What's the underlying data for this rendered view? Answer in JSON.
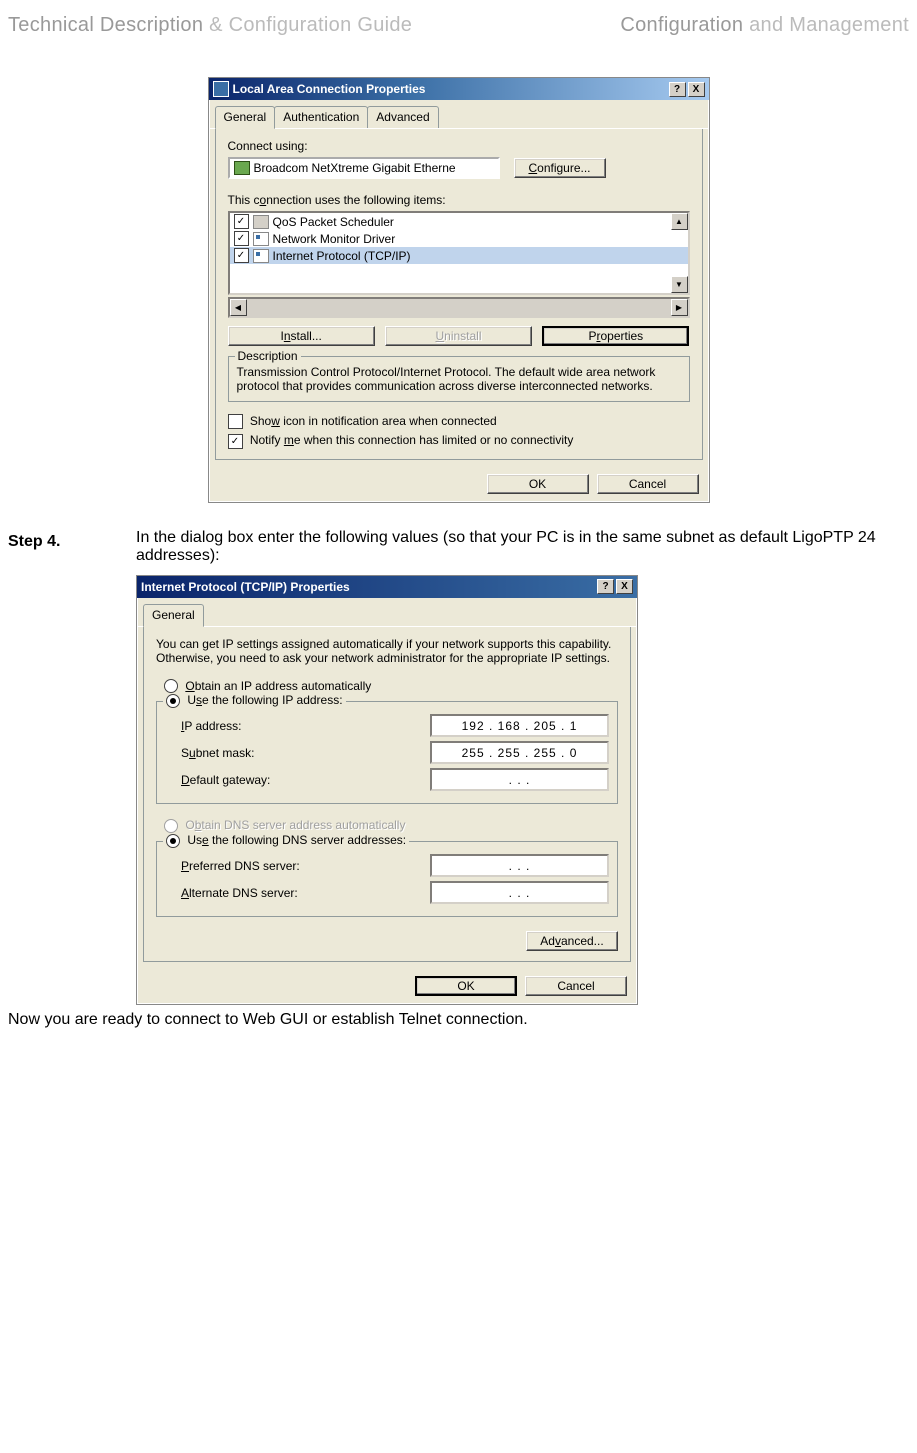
{
  "header": {
    "left_bold": "Technical Description",
    "left_slim": " & Configuration Guide",
    "right_bold": "Configuration",
    "right_slim": " and Management"
  },
  "dialog1": {
    "title": "Local Area Connection Properties",
    "help_btn": "?",
    "close_btn": "X",
    "tabs": [
      "General",
      "Authentication",
      "Advanced"
    ],
    "connect_label": "Connect using:",
    "adapter": "Broadcom NetXtreme Gigabit Etherne",
    "configure_btn": "Configure...",
    "items_label": "This connection uses the following items:",
    "items": [
      {
        "checked": true,
        "label": "QoS Packet Scheduler"
      },
      {
        "checked": true,
        "label": "Network Monitor Driver"
      },
      {
        "checked": true,
        "label": "Internet Protocol (TCP/IP)",
        "selected": true
      }
    ],
    "install_btn": "Install...",
    "uninstall_btn": "Uninstall",
    "properties_btn": "Properties",
    "desc_legend": "Description",
    "desc_text": "Transmission Control Protocol/Internet Protocol. The default wide area network protocol that provides communication across diverse interconnected networks.",
    "show_icon": {
      "checked": false,
      "label": "Show icon in notification area when connected"
    },
    "notify": {
      "checked": true,
      "label": "Notify me when this connection has limited or no connectivity"
    },
    "ok": "OK",
    "cancel": "Cancel"
  },
  "step4": {
    "label": "Step 4.",
    "text": "In the dialog box enter the following values (so that your PC is in the same subnet as default LigoPTP 24 addresses):"
  },
  "dialog2": {
    "title": "Internet Protocol (TCP/IP) Properties",
    "help_btn": "?",
    "close_btn": "X",
    "tab": "General",
    "intro": "You can get IP settings assigned automatically if your network supports this capability. Otherwise, you need to ask your network administrator for the appropriate IP settings.",
    "obtain_ip": "Obtain an IP address automatically",
    "use_ip": "Use the following IP address:",
    "ip_label": "IP address:",
    "ip_value": "192 . 168 . 205 .   1",
    "subnet_label": "Subnet mask:",
    "subnet_value": "255 . 255 . 255 .   0",
    "gateway_label": "Default gateway:",
    "gateway_value": ".       .       .",
    "obtain_dns": "Obtain DNS server address automatically",
    "use_dns": "Use the following DNS server addresses:",
    "pref_dns_label": "Preferred DNS server:",
    "pref_dns_value": ".       .       .",
    "alt_dns_label": "Alternate DNS server:",
    "alt_dns_value": ".       .       .",
    "advanced_btn": "Advanced...",
    "ok": "OK",
    "cancel": "Cancel"
  },
  "footer": "Now you are ready to connect to Web GUI or establish Telnet connection."
}
